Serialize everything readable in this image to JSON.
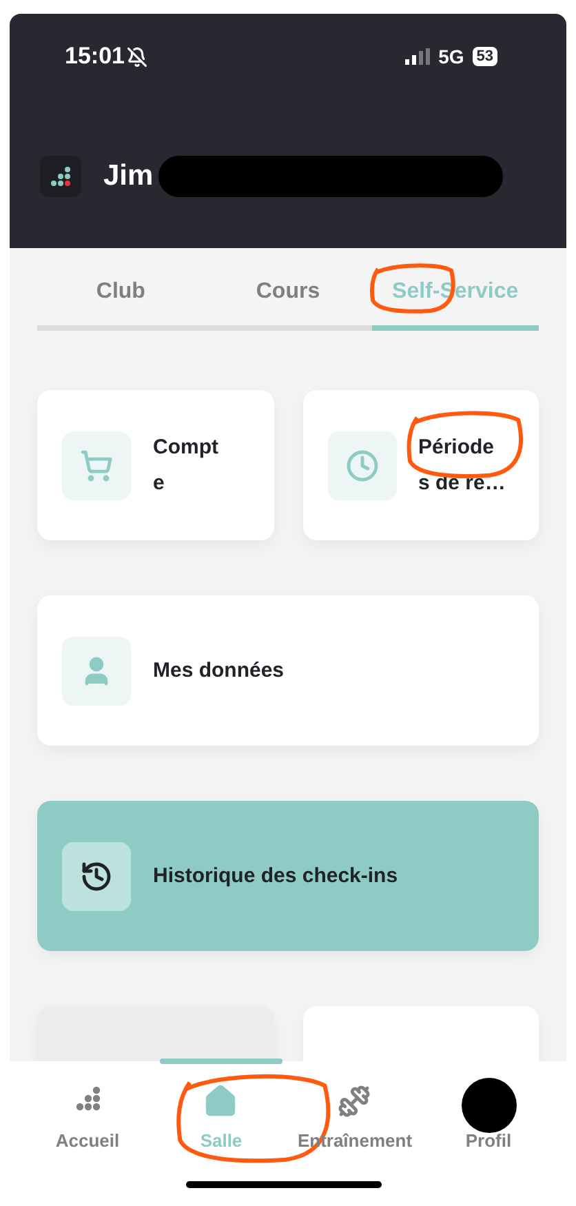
{
  "status_bar": {
    "time": "15:01",
    "network": "5G",
    "battery": "53"
  },
  "header": {
    "title": "Jim",
    "redacted": true
  },
  "tabs": [
    {
      "label": "Club",
      "selected": false,
      "annotated": false
    },
    {
      "label": "Cours",
      "selected": false,
      "annotated": false
    },
    {
      "label": "Self-Service",
      "selected": true,
      "annotated": true
    }
  ],
  "tiles": [
    {
      "kind": "half",
      "label": "Compt\ne",
      "highlighted": false,
      "annotated": false
    },
    {
      "kind": "half",
      "label": "Période\ns de re…",
      "highlighted": false,
      "annotated": true
    },
    {
      "kind": "full",
      "label": "Mes données",
      "highlighted": false,
      "annotated": false
    },
    {
      "kind": "full",
      "label": "Historique des check-ins",
      "highlighted": true,
      "annotated": false
    },
    {
      "kind": "stub",
      "highlighted": false
    },
    {
      "kind": "stub",
      "highlighted": false
    }
  ],
  "bottom_nav": [
    {
      "label": "Accueil",
      "selected": false,
      "annotated": false,
      "redacted": false
    },
    {
      "label": "Salle",
      "selected": true,
      "annotated": true,
      "redacted": false
    },
    {
      "label": "Entraînement",
      "selected": false,
      "annotated": false,
      "redacted": false
    },
    {
      "label": "Profil",
      "selected": false,
      "annotated": false,
      "redacted": true
    }
  ]
}
